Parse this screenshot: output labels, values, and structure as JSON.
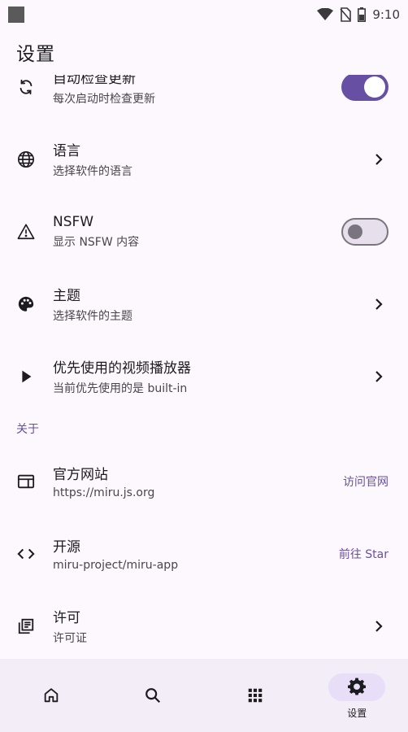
{
  "status": {
    "time": "9:10"
  },
  "app": {
    "title": "设置"
  },
  "settings": {
    "auto_update": {
      "title": "自动检查更新",
      "subtitle": "每次启动时检查更新",
      "enabled": true
    },
    "language": {
      "title": "语言",
      "subtitle": "选择软件的语言"
    },
    "nsfw": {
      "title": "NSFW",
      "subtitle": "显示 NSFW 内容",
      "enabled": false
    },
    "theme": {
      "title": "主题",
      "subtitle": "选择软件的主题"
    },
    "player": {
      "title": "优先使用的视频播放器",
      "subtitle": "当前优先使用的是 built-in"
    }
  },
  "about": {
    "header": "关于",
    "website": {
      "title": "官方网站",
      "subtitle": "https://miru.js.org",
      "action": "访问官网"
    },
    "opensource": {
      "title": "开源",
      "subtitle": "miru-project/miru-app",
      "action": "前往 Star"
    },
    "license": {
      "title": "许可",
      "subtitle": "许可证"
    }
  },
  "nav": {
    "items": [
      {
        "icon": "home-icon",
        "label": ""
      },
      {
        "icon": "search-icon",
        "label": ""
      },
      {
        "icon": "apps-grid-icon",
        "label": ""
      },
      {
        "icon": "gear-icon",
        "label": "设置"
      }
    ],
    "active_index": 3
  },
  "colors": {
    "accent": "#6750a4",
    "background": "#fdf8fd",
    "nav_background": "#f3edf7",
    "nav_indicator": "#e8def8"
  }
}
